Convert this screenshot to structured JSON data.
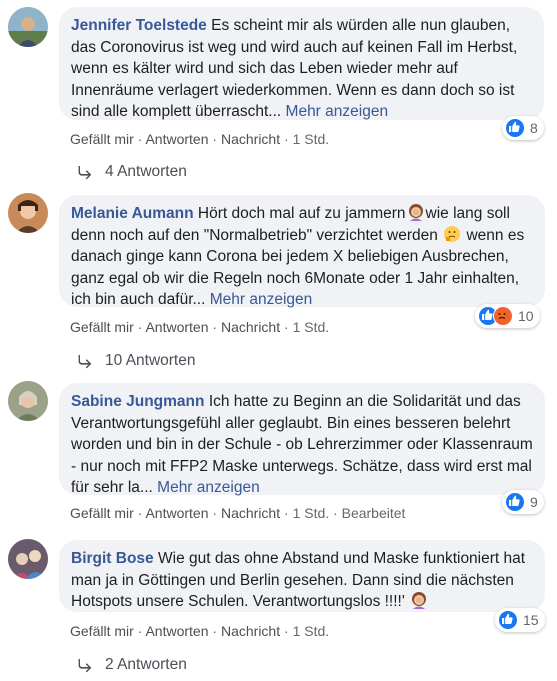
{
  "comments": [
    {
      "author": "Jennifer Toelstede",
      "text": "Es scheint mir als würden alle nun glauben, das Coronovirus ist weg und wird auch auf keinen Fall im Herbst, wenn es kälter wird und sich das Leben wieder mehr auf Innenräume verlagert wiederkommen. Wenn es dann doch so ist sind alle komplett überrascht...",
      "more": "Mehr anzeigen",
      "reaction_count": "8",
      "reactions": [
        "like"
      ],
      "actions": {
        "like": "Gefällt mir",
        "reply": "Antworten",
        "message": "Nachricht",
        "time": "1 Std."
      },
      "replies_label": "4 Antworten"
    },
    {
      "author": "Melanie Aumann",
      "text_before_emoji1": "Hört doch mal auf zu jammern",
      "text_between": "wie lang soll denn noch auf den \"Normalbetrieb\" verzichtet werden",
      "text_after": "wenn es danach ginge kann Corona bei jedem X beliebigen Ausbrechen, ganz egal ob wir die Regeln noch 6Monate oder 1 Jahr einhalten, ich bin auch dafür...",
      "more": "Mehr anzeigen",
      "emoji1": "woman-facepalming",
      "emoji2": "thinking-face",
      "reaction_count": "10",
      "reactions": [
        "like",
        "angry"
      ],
      "actions": {
        "like": "Gefällt mir",
        "reply": "Antworten",
        "message": "Nachricht",
        "time": "1 Std."
      },
      "replies_label": "10 Antworten"
    },
    {
      "author": "Sabine Jungmann",
      "text": "Ich hatte zu Beginn an die Solidarität und das Verantwortungsgefühl aller geglaubt. Bin eines besseren belehrt worden und bin in der Schule - ob Lehrerzimmer oder Klassenraum - nur noch mit FFP2 Maske unterwegs. Schätze, dass wird erst mal für sehr la...",
      "more": "Mehr anzeigen",
      "reaction_count": "9",
      "reactions": [
        "like"
      ],
      "actions": {
        "like": "Gefällt mir",
        "reply": "Antworten",
        "message": "Nachricht",
        "time": "1 Std.",
        "edited": "Bearbeitet"
      }
    },
    {
      "author": "Birgit Bose",
      "text": "Wie gut das ohne Abstand und Maske funktioniert hat man ja in Göttingen und Berlin gesehen. Dann sind die nächsten Hotspots unsere Schulen. Verantwortungslos !!!!'",
      "emoji": "woman-facepalming",
      "reaction_count": "15",
      "reactions": [
        "like"
      ],
      "actions": {
        "like": "Gefällt mir",
        "reply": "Antworten",
        "message": "Nachricht",
        "time": "1 Std."
      },
      "replies_label": "2 Antworten"
    }
  ],
  "colors": {
    "author": "#385898",
    "bubble": "#f0f2f5",
    "like": "#1877f2",
    "angry": "#f0642c",
    "meta": "#65676b"
  }
}
